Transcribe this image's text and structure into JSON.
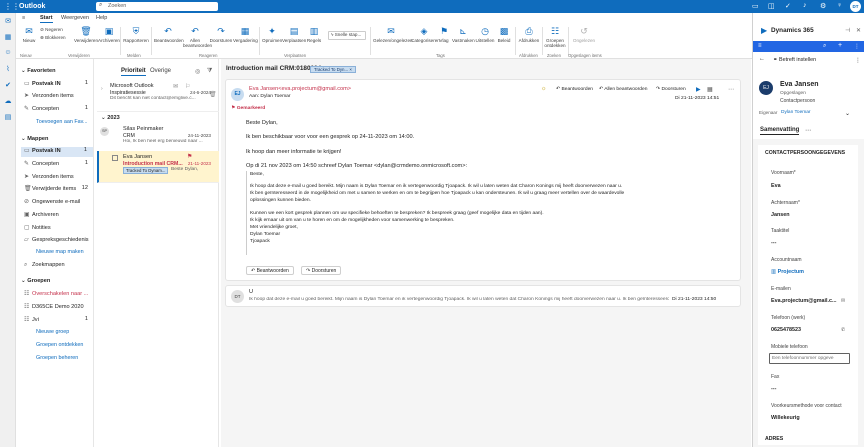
{
  "topbar": {
    "app": "Outlook",
    "search_placeholder": "Zoeken",
    "user_initials": "DT"
  },
  "menu": {
    "tabs": [
      "Start",
      "Weergeven",
      "Help"
    ]
  },
  "ribbon": {
    "new": "Nieuw",
    "ignore": "Negeren",
    "block": "Blokkeren",
    "delete": "Verwijderen",
    "archive": "Archiveren",
    "report": "Rapporteren",
    "reply": "Beantwoorden",
    "reply_all": "Allen beantwoorden",
    "forward": "Doorsturen",
    "meeting": "Vergadering",
    "sweep": "Opruimen",
    "move": "Verplaatsen",
    "rules": "Regels",
    "quick_steps": "Snelle stap...",
    "read_unread": "Gelezen/ongelezen",
    "categorize": "Categoriseren",
    "flag": "Vlag",
    "pin": "Vastmaken",
    "snooze": "Uitstellen",
    "policy": "Beleid",
    "print": "Afdrukken",
    "groups": "Groepen ontdekken",
    "blocked": "Ongelezen",
    "groups_labels": [
      "Nieuw",
      "Verwijderen",
      "Melden",
      "Reageren",
      "Verplaatsen",
      "Tags",
      "Afdrukken",
      "Zoeken",
      "Opgeslagen items"
    ]
  },
  "folders": {
    "favorites": "Favorieten",
    "fav_items": [
      {
        "label": "Postvak IN",
        "count": "1"
      },
      {
        "label": "Verzonden items",
        "count": ""
      },
      {
        "label": "Concepten",
        "count": "1"
      }
    ],
    "add_fav": "Toevoegen aan Fav...",
    "folders_title": "Mappen",
    "items": [
      {
        "label": "Postvak IN",
        "count": "1"
      },
      {
        "label": "Concepten",
        "count": "1"
      },
      {
        "label": "Verzonden items",
        "count": ""
      },
      {
        "label": "Verwijderde items",
        "count": "12"
      },
      {
        "label": "Ongewenste e-mail",
        "count": ""
      },
      {
        "label": "Archiveren",
        "count": ""
      },
      {
        "label": "Notities",
        "count": ""
      },
      {
        "label": "Gespreksgeschiedenis",
        "count": ""
      },
      {
        "label": "Zoekmappen",
        "count": ""
      }
    ],
    "new_folder": "Nieuwe map maken",
    "groups_title": "Groepen",
    "groups": [
      {
        "label": "Overschakelen naar ...",
        "count": ""
      },
      {
        "label": "D365CE Demo 2020",
        "count": ""
      },
      {
        "label": "Jvi",
        "count": "1"
      }
    ],
    "new_group": "Nieuwe groep",
    "discover": "Groepen ontdekken",
    "manage": "Groepen beheren"
  },
  "list": {
    "tabs": [
      "Prioriteit",
      "Overige"
    ],
    "items": [
      {
        "avatar": "",
        "sender": "Microsoft Outlook",
        "subject": "Inspiratiesessie",
        "preview": "Dit bericht kan niet contact@emglive.c...",
        "date": "24-6-2024"
      },
      {
        "avatar": "SP",
        "sender": "Silas Peinmaker",
        "subject": "CRM",
        "preview": "Hoi, Ik ben heel erg benieuwd naar ...",
        "date": "24-11-2023"
      },
      {
        "avatar": "",
        "sender": "Eva Jansen",
        "subject": "Introduction mail CRM...",
        "preview": "Beste Dylan,",
        "date": "21-11-2023",
        "tag": "Tracked To Dynam..."
      }
    ],
    "group_label": "2023"
  },
  "reading": {
    "title": "Introduction mail CRM:0180004",
    "tag": "Tracked To Dyn...",
    "from": "Eva Jansen<eva.projectum@gmail.com>",
    "to": "Aan: Dylan Toemar",
    "initials": "EJ",
    "marked": "Gemarkeerd",
    "date": "Di 21-11-2023 14:51",
    "reply": "Beantwoorden",
    "reply_all": "Allen beantwoorden",
    "forward": "Doorsturen",
    "body": [
      "Beste Dylan,",
      "Ik ben beschikbaar voor voor een gesprek op 24-11-2023 om 14:00.",
      "Ik hoop dan meer informatie te krijgen!"
    ],
    "quote_head": "Op di 21 nov 2023 om 14:50 schreef Dylan Toemar <dylan@crmdemo.onmicrosoft.com>:",
    "quote": [
      "Beste,",
      "Ik hoop dat deze e-mail u goed bereikt. Mijn naam is Dylan Toemar en ik vertegenwoordig Tjoapack. Ik wil u laten weten dat Charon Konings mij heeft doorverwezen naar u.",
      "Ik ben geïnteresseerd in de mogelijkheid om met u samen te werken en om te begrijpen hoe Tjoapack u kan ondersteunen. Ik wil u graag meer vertellen over de waardevolle",
      "oplossingen kunnen bieden.",
      "Kunnen we een kort gesprek plannen om uw specifieke behoeften te bespreken? Ik bespreek graag (geef mogelijke data en tijden aan).",
      "Ik kijk ernaar uit om van u te horen en om de mogelijkheden voor samenwerking te bespreken.",
      "Met vriendelijke groet,",
      "Dylan Toemar",
      "Tjoapack"
    ],
    "second_initials": "DT",
    "second_from": "U",
    "second_preview": "Ik hoop dat deze e-mail u goed bereikt. Mijn naam is Dylan Toemar en ik vertegenwoordig Tjoapack. Ik wil u laten weten dat Charon Konings mij heeft doorverwezen naar u. Ik ben geïnteresseerd in...",
    "second_date": "Di 21-11-2023 14:50"
  },
  "dynamics": {
    "title": "Dynamics 365",
    "regarding": "Betreft instellen",
    "name": "Eva Jansen",
    "saved": "Opgeslagen",
    "type": "Contactpersoon",
    "owner_label": "Eigenaar",
    "owner": "Dylan Toemar",
    "initials": "EJ",
    "tab": "Samenvatting",
    "section": "CONTACTPERSOONGEGEVENS",
    "fields": [
      {
        "label": "Voornaam*",
        "value": "Eva"
      },
      {
        "label": "Achternaam*",
        "value": "Jansen"
      },
      {
        "label": "Taaktitel",
        "value": "---"
      },
      {
        "label": "Accountnaam",
        "value": "Projectum"
      },
      {
        "label": "E-mailen",
        "value": "Eva.projectum@gmail.c..."
      },
      {
        "label": "Telefoon (werk)",
        "value": "0625478523"
      },
      {
        "label": "Mobiele telefoon",
        "value": ""
      },
      {
        "label": "Fax",
        "value": "---"
      },
      {
        "label": "Voorkeursmethode voor contact",
        "value": "Willekeurig"
      }
    ],
    "mobile_placeholder": "Een telefoonnummer opgeve",
    "address": "ADRES"
  }
}
